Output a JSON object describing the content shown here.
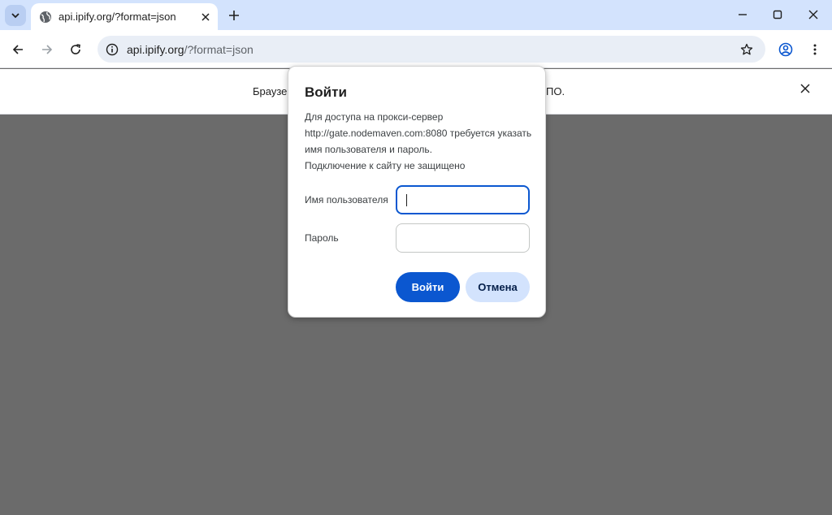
{
  "tab": {
    "title": "api.ipify.org/?format=json"
  },
  "toolbar": {
    "url_host": "api.ipify.org",
    "url_path": "/?format=json"
  },
  "infobar": {
    "text_left": "Браузер",
    "text_right": "ПО."
  },
  "dialog": {
    "title": "Войти",
    "message": "Для доступа на прокси-сервер http://gate.nodemaven.com:8080 требуется указать имя пользователя и пароль.",
    "security_note": "Подключение к сайту не защищено",
    "username_label": "Имя пользователя",
    "username_value": "",
    "password_label": "Пароль",
    "password_value": "",
    "login_button": "Войти",
    "cancel_button": "Отмена"
  },
  "colors": {
    "tabstrip_bg": "#d3e3fd",
    "accent": "#0b57d0",
    "page_bg": "#6b6b6b"
  }
}
